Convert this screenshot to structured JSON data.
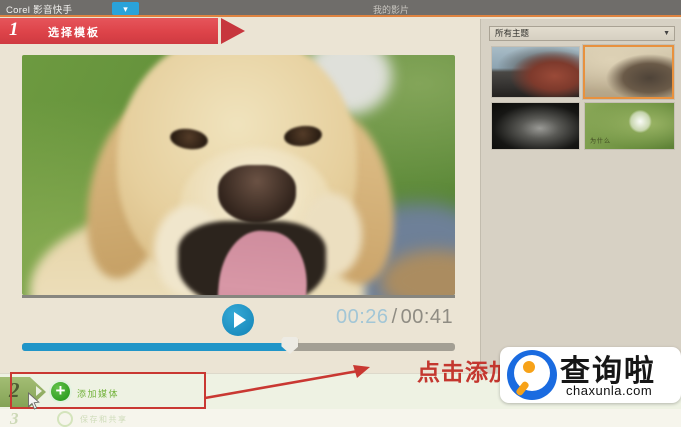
{
  "app": {
    "title": "Corel 影音快手",
    "nav_tab": "我的影片"
  },
  "steps": [
    {
      "number": "1",
      "label": "选择模板"
    },
    {
      "number": "2",
      "label": "添加媒体"
    },
    {
      "number": "3",
      "label": "保存和共享"
    }
  ],
  "player": {
    "current_time": "00:26",
    "separator": "/",
    "total_time": "00:41",
    "progress_percent": 62
  },
  "sidebar": {
    "theme_filter_label": "所有主题",
    "thumbnails": [
      {
        "name": "vw-bus-color",
        "selected": false,
        "caption": ""
      },
      {
        "name": "vw-bus-vintage",
        "selected": true,
        "caption": ""
      },
      {
        "name": "vw-bus-mono",
        "selected": false,
        "caption": ""
      },
      {
        "name": "dandelion",
        "selected": false,
        "caption": "为什么"
      }
    ]
  },
  "annotations": {
    "tip_text": "点击添加"
  },
  "watermark": {
    "brand": "查询啦",
    "domain": "chaxunla.com"
  },
  "icons": {
    "plus": "+",
    "dropdown_arrow": "▼",
    "chevron_down": "▾"
  },
  "colors": {
    "banner_red": "#dd4349",
    "accent_blue": "#2095c8",
    "accent_green": "#3fa62e",
    "selection_orange": "#e8913e",
    "topbar_gray": "#6f6d6a",
    "annotation_red": "#c93832",
    "background_beige": "#ebe4d4"
  }
}
